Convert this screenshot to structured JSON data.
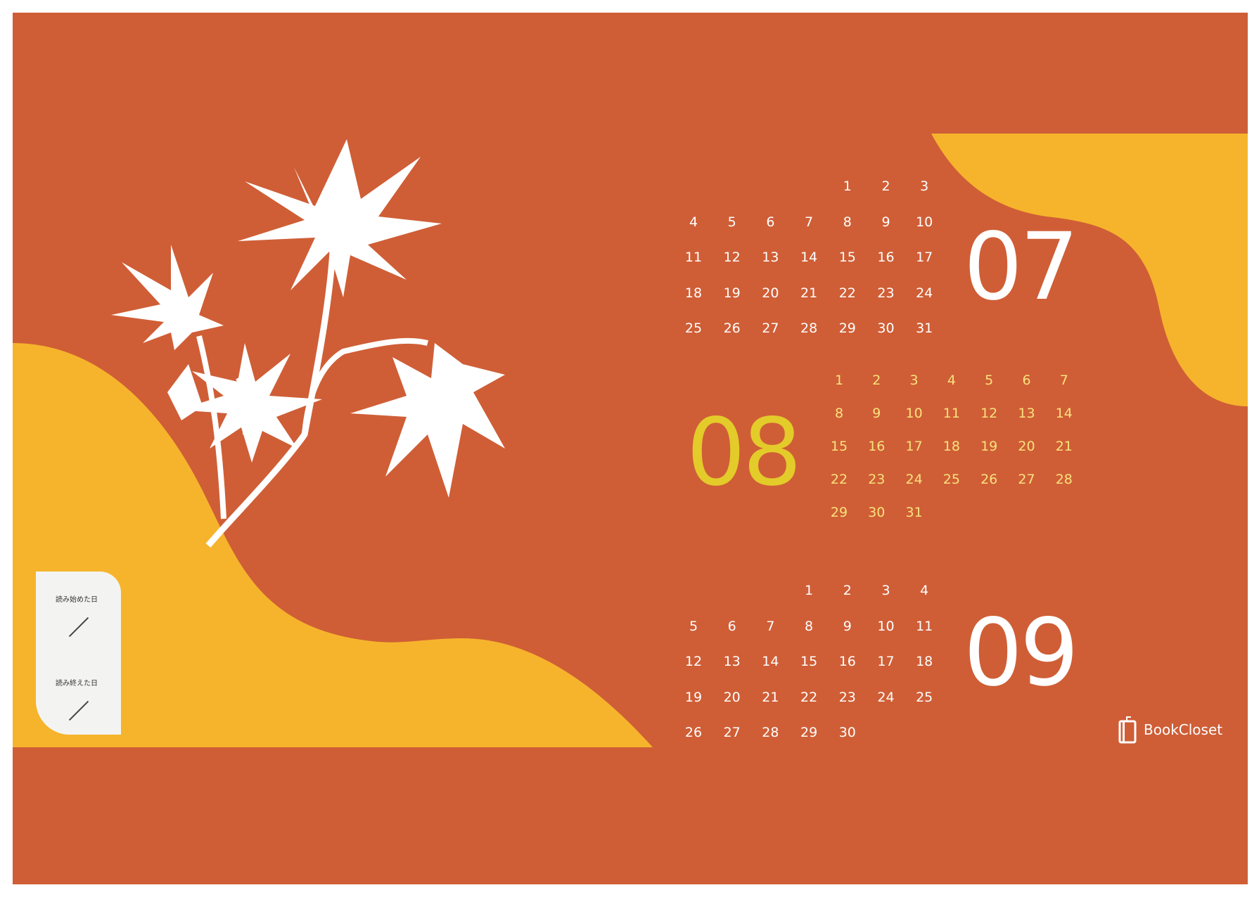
{
  "colors": {
    "background": "#CF5E36",
    "accent_yellow": "#F6B42C",
    "leaf": "#FFFFFF",
    "aug_text": "#F8E27C",
    "aug_number": "#E3CB2A",
    "card": "#F3F4F2"
  },
  "months": {
    "july": {
      "label": "07",
      "days": [
        [
          null,
          null,
          null,
          null,
          "1",
          "2",
          "3"
        ],
        [
          "4",
          "5",
          "6",
          "7",
          "8",
          "9",
          "10"
        ],
        [
          "11",
          "12",
          "13",
          "14",
          "15",
          "16",
          "17"
        ],
        [
          "18",
          "19",
          "20",
          "21",
          "22",
          "23",
          "24"
        ],
        [
          "25",
          "26",
          "27",
          "28",
          "29",
          "30",
          "31"
        ]
      ]
    },
    "august": {
      "label": "08",
      "days": [
        [
          "1",
          "2",
          "3",
          "4",
          "5",
          "6",
          "7"
        ],
        [
          "8",
          "9",
          "10",
          "11",
          "12",
          "13",
          "14"
        ],
        [
          "15",
          "16",
          "17",
          "18",
          "19",
          "20",
          "21"
        ],
        [
          "22",
          "23",
          "24",
          "25",
          "26",
          "27",
          "28"
        ],
        [
          "29",
          "30",
          "31",
          null,
          null,
          null,
          null
        ]
      ]
    },
    "september": {
      "label": "09",
      "days": [
        [
          null,
          null,
          null,
          "1",
          "2",
          "3",
          "4"
        ],
        [
          "5",
          "6",
          "7",
          "8",
          "9",
          "10",
          "11"
        ],
        [
          "12",
          "13",
          "14",
          "15",
          "16",
          "17",
          "18"
        ],
        [
          "19",
          "20",
          "21",
          "22",
          "23",
          "24",
          "25"
        ],
        [
          "26",
          "27",
          "28",
          "29",
          "30",
          null,
          null
        ]
      ]
    }
  },
  "memo": {
    "start_label": "読み始めた日",
    "end_label": "読み終えた日"
  },
  "logo": {
    "text": "BookCloset",
    "icon": "book-icon"
  }
}
